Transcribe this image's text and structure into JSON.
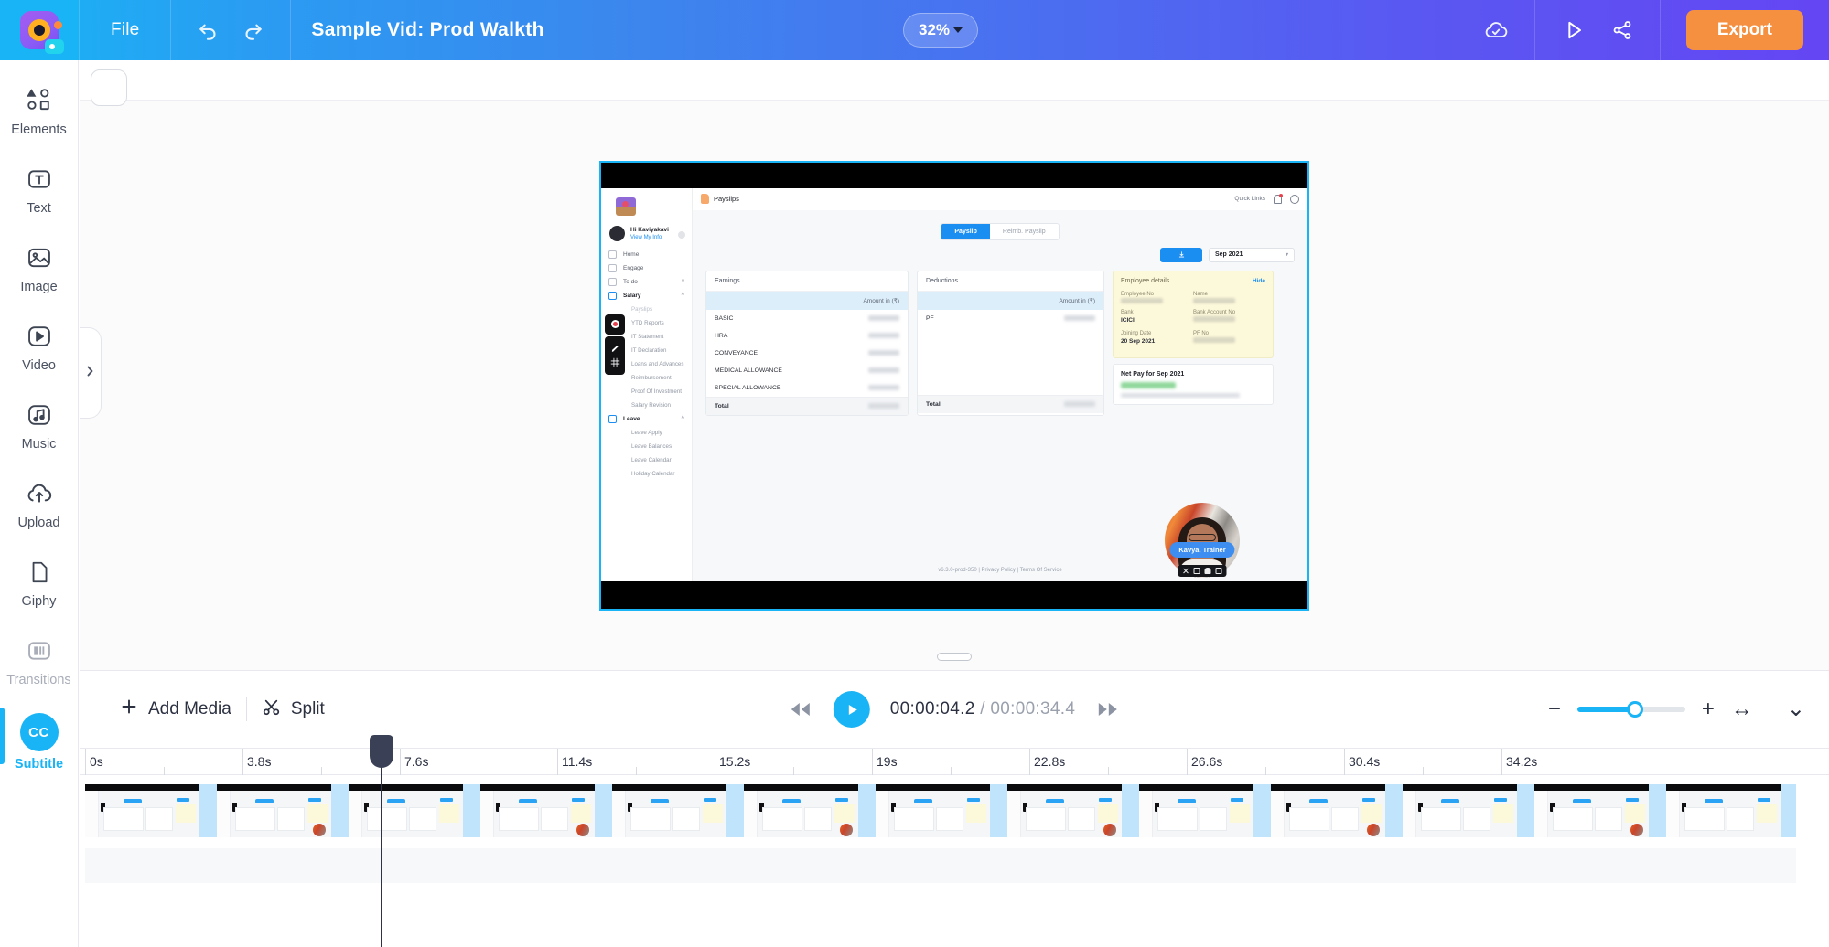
{
  "header": {
    "logo_name": "app-logo",
    "file_menu": "File",
    "undo_icon": "undo-icon",
    "redo_icon": "redo-icon",
    "project_title": "Sample Vid: Prod Walkth",
    "zoom_level": "32%",
    "cloud_save_icon": "cloud-check-icon",
    "preview_icon": "play-preview-icon",
    "share_icon": "share-icon",
    "export_label": "Export",
    "accent_gradient_start": "#19b4f5",
    "accent_gradient_end": "#6446f3",
    "export_color": "#f49040"
  },
  "sidebar": {
    "items": [
      {
        "label": "Elements",
        "icon": "shapes-icon",
        "state": "normal"
      },
      {
        "label": "Text",
        "icon": "text-box-icon",
        "state": "normal"
      },
      {
        "label": "Image",
        "icon": "image-icon",
        "state": "normal"
      },
      {
        "label": "Video",
        "icon": "video-play-icon",
        "state": "normal"
      },
      {
        "label": "Music",
        "icon": "music-note-icon",
        "state": "normal"
      },
      {
        "label": "Upload",
        "icon": "cloud-upload-icon",
        "state": "normal"
      },
      {
        "label": "Giphy",
        "icon": "page-icon",
        "state": "normal"
      },
      {
        "label": "Transitions",
        "icon": "transitions-icon",
        "state": "dim"
      },
      {
        "label": "Subtitle",
        "icon": "cc-icon",
        "state": "active"
      }
    ],
    "active_color": "#19b4f5",
    "cc_text": "CC"
  },
  "canvas": {
    "tool_square": "empty-tool-button",
    "panel_expander_icon": "chevron-right-icon",
    "resize_handle": "canvas-resize-handle"
  },
  "preview": {
    "app": {
      "breadcrumb": "Payslips",
      "topbar": {
        "quick_links": "Quick Links",
        "bell_icon": "notification-bell-icon",
        "power_icon": "power-icon"
      },
      "sidebar": {
        "greeting": "Hi Kaviyakavi",
        "view_info": "View My Info",
        "nav": [
          {
            "label": "Home",
            "type": "item"
          },
          {
            "label": "Engage",
            "type": "item"
          },
          {
            "label": "To do",
            "type": "item",
            "chevron": "v"
          },
          {
            "label": "Salary",
            "type": "group",
            "chevron": "^"
          },
          {
            "label": "Payslips",
            "type": "sub",
            "selected": true
          },
          {
            "label": "YTD Reports",
            "type": "sub"
          },
          {
            "label": "IT Statement",
            "type": "sub"
          },
          {
            "label": "IT Declaration",
            "type": "sub"
          },
          {
            "label": "Loans and Advances",
            "type": "sub"
          },
          {
            "label": "Reimbursement",
            "type": "sub"
          },
          {
            "label": "Proof Of Investment",
            "type": "sub"
          },
          {
            "label": "Salary Revision",
            "type": "sub"
          },
          {
            "label": "Leave",
            "type": "group",
            "chevron": "^"
          },
          {
            "label": "Leave Apply",
            "type": "sub"
          },
          {
            "label": "Leave Balances",
            "type": "sub"
          },
          {
            "label": "Leave Calendar",
            "type": "sub"
          },
          {
            "label": "Holiday Calendar",
            "type": "sub"
          }
        ]
      },
      "tabs": [
        {
          "label": "Payslip",
          "active": true
        },
        {
          "label": "Reimb. Payslip",
          "active": false
        }
      ],
      "download_icon": "download-icon",
      "month_selector": "Sep 2021",
      "earnings": {
        "title": "Earnings",
        "amount_header": "Amount in (₹)",
        "rows": [
          {
            "label": "BASIC",
            "amount": ""
          },
          {
            "label": "HRA",
            "amount": ""
          },
          {
            "label": "CONVEYANCE",
            "amount": ""
          },
          {
            "label": "MEDICAL ALLOWANCE",
            "amount": ""
          },
          {
            "label": "SPECIAL ALLOWANCE",
            "amount": ""
          }
        ],
        "total_label": "Total"
      },
      "deductions": {
        "title": "Deductions",
        "amount_header": "Amount in (₹)",
        "rows": [
          {
            "label": "PF",
            "amount": ""
          }
        ],
        "total_label": "Total"
      },
      "employee_details": {
        "title": "Employee details",
        "hide_label": "Hide",
        "fields": [
          {
            "key": "Employee No",
            "value": "",
            "masked": true
          },
          {
            "key": "Name",
            "value": "",
            "masked": true
          },
          {
            "key": "Bank",
            "value": "ICICI",
            "masked": false
          },
          {
            "key": "Bank Account No",
            "value": "",
            "masked": true
          },
          {
            "key": "Joining Date",
            "value": "20 Sep 2021",
            "masked": false
          },
          {
            "key": "PF No",
            "value": "",
            "masked": true
          }
        ]
      },
      "net_pay": {
        "title": "Net Pay for Sep 2021"
      },
      "footer": "v6.3.0-prod-350  |  Privacy Policy  |  Terms Of Service"
    },
    "webcam": {
      "label": "Kavya, Trainer",
      "controls": [
        "close-icon",
        "screenshot-icon",
        "person-icon",
        "pip-icon"
      ]
    },
    "recorder_tools": [
      "record-icon",
      "pen-icon",
      "grid-icon"
    ]
  },
  "timeline": {
    "add_media_label": "Add Media",
    "add_media_icon": "plus-icon",
    "split_label": "Split",
    "split_icon": "scissors-icon",
    "skip_back_icon": "skip-back-icon",
    "play_icon": "play-icon",
    "skip_forward_icon": "skip-forward-icon",
    "current_time": "00:00:04.2",
    "separator": "/",
    "total_time": "00:00:34.4",
    "zoom_out_icon": "minus-icon",
    "zoom_in_icon": "plus-icon",
    "fit_icon": "fit-width-icon",
    "collapse_icon": "chevron-down-icon",
    "zoom_value": 46,
    "ruler_labels": [
      "0s",
      "3.8s",
      "7.6s",
      "11.4s",
      "15.2s",
      "19s",
      "22.8s",
      "26.6s",
      "30.4s",
      "34.2s"
    ],
    "playhead_time": "3.8s",
    "clip_count": 14
  }
}
